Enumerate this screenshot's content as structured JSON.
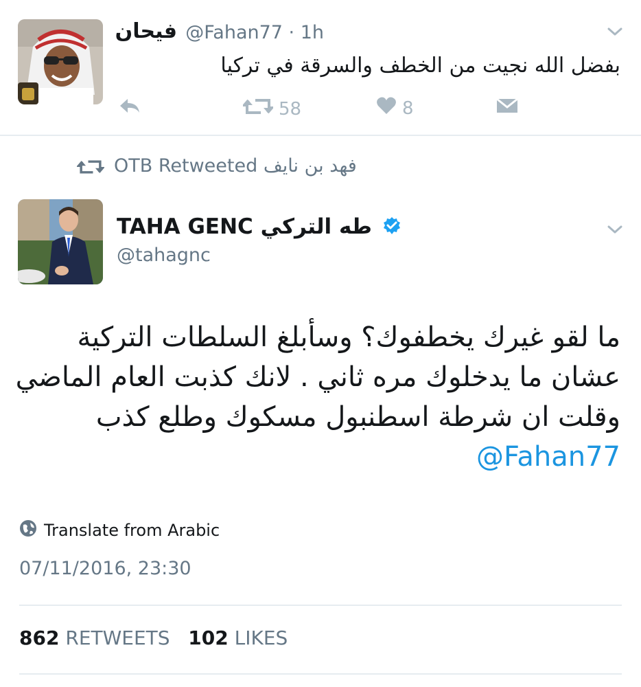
{
  "tweet1": {
    "display_name": "فيحان",
    "handle_time": "@Fahan77 · 1h",
    "text": "بفضل الله نجيت من الخطف والسرقة في تركيا",
    "retweet_count": "58",
    "like_count": "8",
    "icons": [
      "reply-icon",
      "retweet-icon",
      "heart-icon",
      "direct-message-icon",
      "chevron-down-icon"
    ]
  },
  "retweet_banner": {
    "text": "OTB Retweeted فهد بن نايف"
  },
  "tweet2": {
    "display_name": "TAHA GENC طه التركي",
    "handle": "@tahagnc",
    "verified": true,
    "body_lines": [
      "ما لقو  غيرك يخطفوك؟ وسأبلغ السلطات التركية",
      "عشان ما يدخلوك  مره ثاني . لانك كذبت العام الماضي",
      "وقلت ان شرطة اسطنبول مسكوك وطلع كذب"
    ],
    "mention": "@Fahan77",
    "translate_label": "Translate from Arabic",
    "timestamp": "07/11/2016, 23:30",
    "retweets_count": "862",
    "retweets_label": "RETWEETS",
    "likes_count": "102",
    "likes_label": "LIKES"
  },
  "colors": {
    "link": "#1b95e0",
    "muted": "#657786",
    "icon": "#aab8c2",
    "divider": "#e6ecf0",
    "verified": "#1da1f2"
  }
}
